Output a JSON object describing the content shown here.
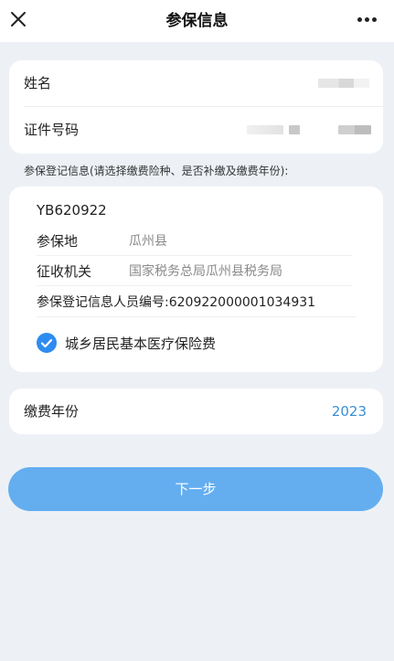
{
  "navbar": {
    "title": "参保信息",
    "close_icon": "close-icon",
    "more_icon": "more-icon"
  },
  "info": {
    "name_label": "姓名",
    "id_label": "证件号码"
  },
  "hint": "参保登记信息(请选择缴费险种、是否补缴及缴费年份):",
  "registration": {
    "code": "YB620922",
    "location_label": "参保地",
    "location_value": "瓜州县",
    "agency_label": "征收机关",
    "agency_value": "国家税务总局瓜州县税务局",
    "person_label": "参保登记信息人员编号:",
    "person_number": "620922000001034931",
    "insurance_type": "城乡居民基本医疗保险费",
    "insurance_checked": true
  },
  "year": {
    "label": "缴费年份",
    "value": "2023"
  },
  "next_button": "下一步",
  "colors": {
    "accent": "#2d8cf0",
    "button": "#64aef0",
    "year_value": "#3a8fd6",
    "background": "#edf1f6"
  }
}
